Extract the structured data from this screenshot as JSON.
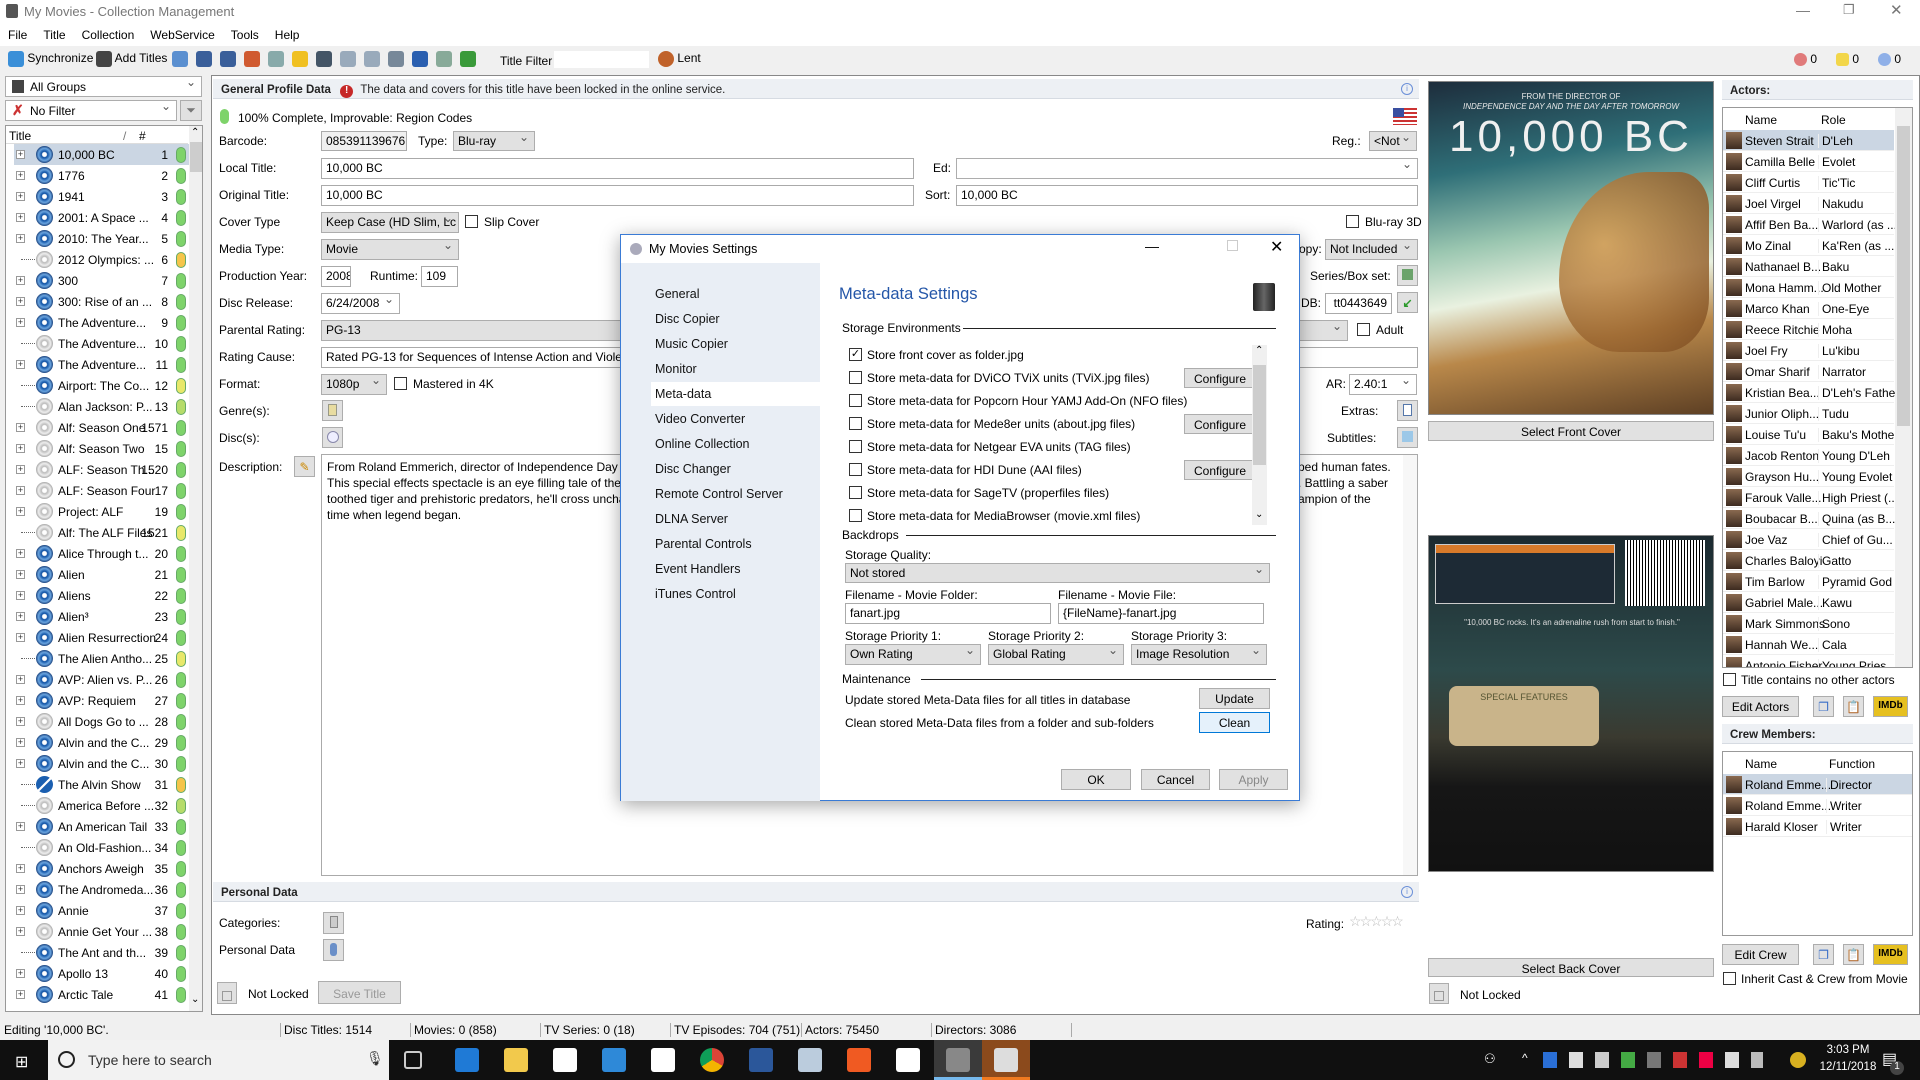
{
  "window": {
    "title": "My Movies - Collection Management"
  },
  "menu": [
    "File",
    "Title",
    "Collection",
    "WebService",
    "Tools",
    "Help"
  ],
  "toolbar": {
    "synchronize": "Synchronize",
    "add_titles": "Add Titles",
    "title_filter_label": "Title Filter",
    "title_filter_value": "",
    "lent": "Lent",
    "errors": "0",
    "warnings": "0",
    "infos": "0"
  },
  "left": {
    "group": "All Groups",
    "filter": "No Filter",
    "col_title": "Title",
    "col_num": "#",
    "rows": [
      [
        "10,000 BC",
        "1",
        "bluray",
        "#7ed36a",
        1
      ],
      [
        "1776",
        "2",
        "bluray",
        "#7ed36a",
        1
      ],
      [
        "1941",
        "3",
        "bluray",
        "#7ed36a",
        1
      ],
      [
        "2001: A Space ...",
        "4",
        "bluray",
        "#7ed36a",
        1
      ],
      [
        "2010: The Year...",
        "5",
        "bluray",
        "#7ed36a",
        1
      ],
      [
        "2012 Olympics: ...",
        "6",
        "dvd",
        "#f5c54a",
        0
      ],
      [
        "300",
        "7",
        "bluray",
        "#7ed36a",
        1
      ],
      [
        "300: Rise of an ...",
        "8",
        "bluray",
        "#7ed36a",
        1
      ],
      [
        "The Adventure...",
        "9",
        "bluray",
        "#7ed36a",
        1
      ],
      [
        "The Adventure...",
        "10",
        "dvd",
        "#7ed36a",
        0
      ],
      [
        "The Adventure...",
        "11",
        "bluray",
        "#7ed36a",
        1
      ],
      [
        "Airport: The Co...",
        "12",
        "bluray",
        "#e8e86a",
        0
      ],
      [
        "Alan Jackson: P...",
        "13",
        "dvd",
        "#b6dc6a",
        0
      ],
      [
        "Alf: Season One",
        "1571",
        "dvd",
        "#7ed36a",
        1
      ],
      [
        "Alf: Season Two",
        "15",
        "dvd",
        "#7ed36a",
        1
      ],
      [
        "ALF: Season Th...",
        "1520",
        "dvd",
        "#7ed36a",
        1
      ],
      [
        "ALF: Season Four",
        "17",
        "dvd",
        "#7ed36a",
        1
      ],
      [
        "Project: ALF",
        "19",
        "dvd",
        "#7ed36a",
        1
      ],
      [
        "Alf: The ALF Files",
        "1521",
        "dvd",
        "#e8e86a",
        0
      ],
      [
        "Alice Through t...",
        "20",
        "bluray",
        "#7ed36a",
        1
      ],
      [
        "Alien",
        "21",
        "bluray",
        "#7ed36a",
        1
      ],
      [
        "Aliens",
        "22",
        "bluray",
        "#7ed36a",
        1
      ],
      [
        "Alien³",
        "23",
        "bluray",
        "#7ed36a",
        1
      ],
      [
        "Alien Resurrection",
        "24",
        "bluray",
        "#7ed36a",
        1
      ],
      [
        "The Alien Antho...",
        "25",
        "bluray",
        "#e8e86a",
        0
      ],
      [
        "AVP: Alien vs. P...",
        "26",
        "bluray",
        "#7ed36a",
        1
      ],
      [
        "AVP: Requiem",
        "27",
        "bluray",
        "#7ed36a",
        1
      ],
      [
        "All Dogs Go to ...",
        "28",
        "dvd",
        "#7ed36a",
        1
      ],
      [
        "Alvin and the C...",
        "29",
        "bluray",
        "#7ed36a",
        1
      ],
      [
        "Alvin and the C...",
        "30",
        "bluray",
        "#7ed36a",
        1
      ],
      [
        "The Alvin Show",
        "31",
        "tv",
        "#f5c54a",
        0
      ],
      [
        "America Before ...",
        "32",
        "dvd",
        "#b6dc6a",
        0
      ],
      [
        "An American Tail",
        "33",
        "bluray",
        "#7ed36a",
        1
      ],
      [
        "An Old-Fashion...",
        "34",
        "dvd",
        "#7ed36a",
        0
      ],
      [
        "Anchors Aweigh",
        "35",
        "bluray",
        "#7ed36a",
        1
      ],
      [
        "The Andromeda...",
        "36",
        "bluray",
        "#7ed36a",
        1
      ],
      [
        "Annie",
        "37",
        "bluray",
        "#7ed36a",
        1
      ],
      [
        "Annie Get Your ...",
        "38",
        "dvd",
        "#7ed36a",
        1
      ],
      [
        "The Ant and th...",
        "39",
        "bluray",
        "#7ed36a",
        0
      ],
      [
        "Apollo 13",
        "40",
        "bluray",
        "#7ed36a",
        1
      ],
      [
        "Arctic Tale",
        "41",
        "bluray",
        "#7ed36a",
        1
      ]
    ]
  },
  "profile": {
    "header": "General Profile Data",
    "lock_msg": "The data and covers for this title have been locked in the online service.",
    "completeness": "100% Complete, Improvable: Region Codes",
    "barcode_label": "Barcode:",
    "barcode": "085391139676",
    "type_label": "Type:",
    "type": "Blu-ray",
    "reg_label": "Reg.:",
    "reg": "<Not",
    "local_title_label": "Local Title:",
    "local_title": "10,000 BC",
    "ed_label": "Ed:",
    "ed": "",
    "original_title_label": "Original Title:",
    "original_title": "10,000 BC",
    "sort_label": "Sort:",
    "sort": "10,000 BC",
    "cover_type_label": "Cover Type",
    "cover_type": "Keep Case (HD Slim, Lc",
    "slip_cover": "Slip Cover",
    "bluray3d": "Blu-ray 3D",
    "media_type_label": "Media Type:",
    "media_type": "Movie",
    "copy_label": "opy:",
    "copy": "Not Included",
    "production_year_label": "Production Year:",
    "production_year": "2008",
    "runtime_label": "Runtime:",
    "runtime": "109",
    "series_label": "Series/Box set:",
    "disc_release_label": "Disc Release:",
    "disc_release": "6/24/2008",
    "imdb_label": "DB:",
    "imdb": "tt0443649",
    "parental_rating_label": "Parental Rating:",
    "parental_rating": "PG-13",
    "adult": "Adult",
    "rating_cause_label": "Rating Cause:",
    "rating_cause": "Rated PG-13 for Sequences of Intense Action and Violenc",
    "format_label": "Format:",
    "format": "1080p",
    "mastered4k": "Mastered in 4K",
    "ar_label": "AR:",
    "ar": "2.40:1",
    "genres_label": "Genre(s):",
    "discs_label": "Disc(s):",
    "extras_label": "Extras:",
    "subtitles_label": "Subtitles:",
    "description_label": "Description:",
    "description_left": [
      "From Roland Emmerich, director of Independence Day an",
      "This special effects spectacle is an eye filling tale of the fi",
      "toothed tiger and prehistoric predators, he'll cross uncha",
      "time when legend began."
    ],
    "description_right": [
      "ped human fates.",
      ". Battling a saber",
      "ampion of the",
      ""
    ]
  },
  "personal": {
    "header": "Personal Data",
    "categories": "Categories:",
    "personal_data": "Personal Data",
    "rating_label": "Rating:",
    "rating": 0,
    "not_locked": "Not Locked",
    "save_title": "Save Title"
  },
  "covers": {
    "front_small": "FROM THE DIRECTOR OF",
    "front_line2": "INDEPENDENCE DAY AND THE DAY AFTER TOMORROW",
    "front_title": "10,000 BC",
    "select_front": "Select Front Cover",
    "back_quote": "\"10,000 BC rocks. It's an adrenaline rush from start to finish.\"",
    "back_features": "SPECIAL FEATURES",
    "select_back": "Select Back Cover",
    "not_locked": "Not Locked"
  },
  "actors": {
    "header": "Actors:",
    "col_name": "Name",
    "col_role": "Role",
    "rows": [
      [
        "Steven Strait",
        "D'Leh"
      ],
      [
        "Camilla Belle",
        "Evolet"
      ],
      [
        "Cliff Curtis",
        "Tic'Tic"
      ],
      [
        "Joel Virgel",
        "Nakudu"
      ],
      [
        "Affif Ben Ba...",
        "Warlord (as ..."
      ],
      [
        "Mo Zinal",
        "Ka'Ren (as ..."
      ],
      [
        "Nathanael B...",
        "Baku"
      ],
      [
        "Mona Hamm...",
        "Old Mother"
      ],
      [
        "Marco Khan",
        "One-Eye"
      ],
      [
        "Reece Ritchie",
        "Moha"
      ],
      [
        "Joel Fry",
        "Lu'kibu"
      ],
      [
        "Omar Sharif",
        "Narrator"
      ],
      [
        "Kristian Bea...",
        "D'Leh's Father"
      ],
      [
        "Junior Oliph...",
        "Tudu"
      ],
      [
        "Louise Tu'u",
        "Baku's Mother"
      ],
      [
        "Jacob Renton",
        "Young D'Leh"
      ],
      [
        "Grayson Hu...",
        "Young Evolet"
      ],
      [
        "Farouk Valle...",
        "High Priest (..."
      ],
      [
        "Boubacar B...",
        "Quina (as B..."
      ],
      [
        "Joe Vaz",
        "Chief of Gu..."
      ],
      [
        "Charles Baloyi",
        "Gatto"
      ],
      [
        "Tim Barlow",
        "Pyramid God"
      ],
      [
        "Gabriel Male...",
        "Kawu"
      ],
      [
        "Mark Simmons",
        "Sono"
      ],
      [
        "Hannah We...",
        "Cala"
      ],
      [
        "Antonio Fisher",
        "Young Pries"
      ]
    ],
    "no_other": "Title contains no other actors",
    "edit": "Edit Actors",
    "imdb": "IMDb"
  },
  "crew": {
    "header": "Crew Members:",
    "col_name": "Name",
    "col_function": "Function",
    "rows": [
      [
        "Roland Emme...",
        "Director"
      ],
      [
        "Roland Emme...",
        "Writer"
      ],
      [
        "Harald Kloser",
        "Writer"
      ]
    ],
    "edit": "Edit Crew",
    "inherit": "Inherit Cast & Crew from Movie",
    "imdb": "IMDb"
  },
  "status": {
    "editing": "Editing '10,000 BC'.",
    "disc_titles": "Disc Titles: 1514",
    "movies": "Movies: 0 (858)",
    "tv_series": "TV Series: 0 (18)",
    "tv_episodes": "TV Episodes: 704 (751)",
    "actors": "Actors: 75450",
    "directors": "Directors: 3086"
  },
  "dialog": {
    "title": "My Movies Settings",
    "nav": [
      "General",
      "Disc Copier",
      "Music Copier",
      "Monitor",
      "Meta-data",
      "Video Converter",
      "Online Collection",
      "Disc Changer",
      "Remote Control Server",
      "DLNA Server",
      "Parental Controls",
      "Event Handlers",
      "iTunes Control"
    ],
    "selected_nav": "Meta-data",
    "heading": "Meta-data Settings",
    "storage_env": "Storage Environments",
    "options": [
      [
        "Store front cover as folder.jpg",
        true,
        false
      ],
      [
        "Store meta-data for DViCO TViX units (TViX.jpg files)",
        false,
        true
      ],
      [
        "Store meta-data for Popcorn Hour YAMJ Add-On (NFO files)",
        false,
        false
      ],
      [
        "Store meta-data for Mede8er units (about.jpg files)",
        false,
        true
      ],
      [
        "Store meta-data for Netgear EVA units (TAG files)",
        false,
        false
      ],
      [
        "Store meta-data for HDI Dune (AAI files)",
        false,
        true
      ],
      [
        "Store meta-data for SageTV (properfiles files)",
        false,
        false
      ],
      [
        "Store meta-data for MediaBrowser (movie.xml files)",
        false,
        false
      ]
    ],
    "configure": "Configure",
    "backdrops": "Backdrops",
    "storage_quality_label": "Storage Quality:",
    "storage_quality": "Not stored",
    "fn_folder_label": "Filename - Movie Folder:",
    "fn_folder": "fanart.jpg",
    "fn_file_label": "Filename - Movie File:",
    "fn_file": "{FileName}-fanart.jpg",
    "p1_label": "Storage Priority 1:",
    "p1": "Own Rating",
    "p2_label": "Storage Priority 2:",
    "p2": "Global Rating",
    "p3_label": "Storage Priority 3:",
    "p3": "Image Resolution",
    "maintenance": "Maintenance",
    "update_text": "Update stored Meta-Data files for all titles in database",
    "update": "Update",
    "clean_text": "Clean stored Meta-Data files from a folder and sub-folders",
    "clean": "Clean",
    "ok": "OK",
    "cancel": "Cancel",
    "apply": "Apply"
  },
  "taskbar": {
    "search_placeholder": "Type here to search",
    "time": "3:03 PM",
    "date": "12/11/2018",
    "notifications": "1"
  }
}
